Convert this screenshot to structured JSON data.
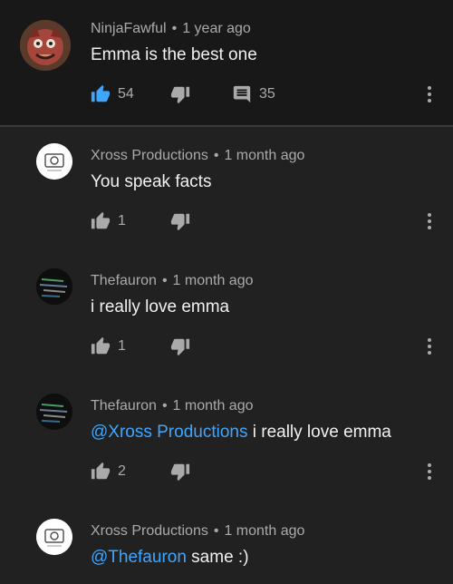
{
  "comments": [
    {
      "author": "NinjaFawful",
      "time": "1 year ago",
      "text": "Emma is the best one",
      "mention": "",
      "likes": "54",
      "replies": "35",
      "liked": true
    },
    {
      "author": "Xross Productions",
      "time": "1 month ago",
      "text": "You speak facts",
      "mention": "",
      "likes": "1",
      "liked": false
    },
    {
      "author": "Thefauron",
      "time": "1 month ago",
      "text": "i really love emma",
      "mention": "",
      "likes": "1",
      "liked": false
    },
    {
      "author": "Thefauron",
      "time": "1 month ago",
      "text": " i really love emma",
      "mention": "@Xross Productions",
      "likes": "2",
      "liked": false
    },
    {
      "author": "Xross Productions",
      "time": "1 month ago",
      "text": " same :)",
      "mention": "@Thefauron",
      "liked": false
    }
  ],
  "separator": "•",
  "colors": {
    "liked_blue": "#3ea6ff",
    "icon_gray": "#aaaaaa",
    "mention_blue": "#3ea6ff"
  },
  "icons": {
    "like": "thumbs-up-icon",
    "dislike": "thumbs-down-icon",
    "reply": "comment-icon",
    "more": "more-vertical-icon"
  }
}
